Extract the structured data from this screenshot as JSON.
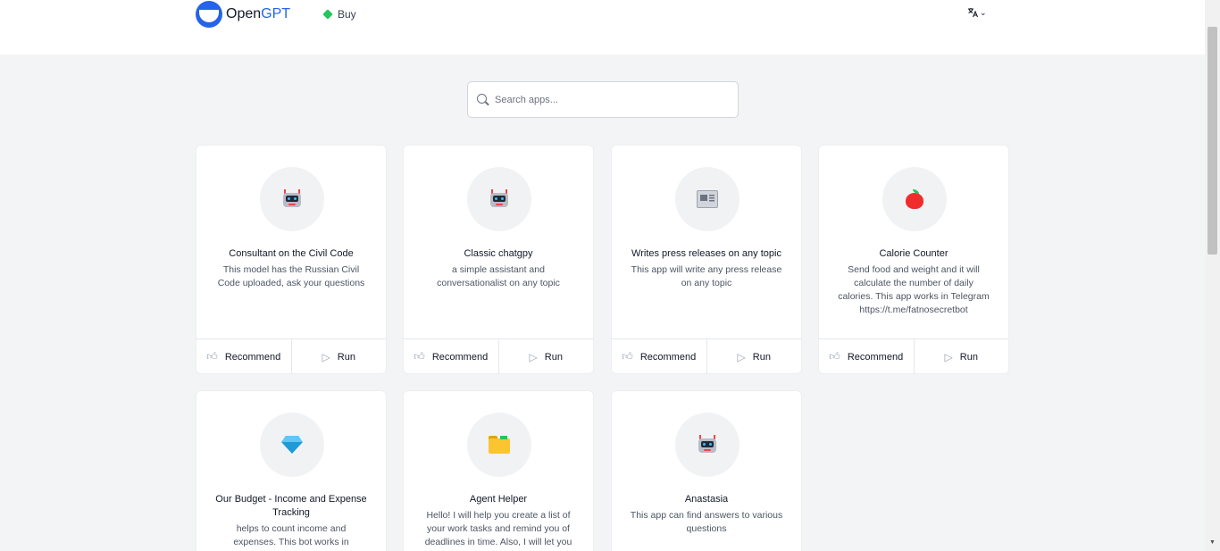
{
  "header": {
    "logo_prefix": "Open",
    "logo_suffix": "GPT",
    "buy_label": "Buy",
    "language_icon": "translate-icon",
    "accent_color": "#2563eb"
  },
  "search": {
    "placeholder": "Search apps..."
  },
  "actions": {
    "recommend_label": "Recommend",
    "run_label": "Run"
  },
  "apps": [
    {
      "title": "Consultant on the Civil Code",
      "description": "This model has the Russian Civil Code uploaded, ask your questions",
      "icon": "robot-icon"
    },
    {
      "title": "Classic chatgpy",
      "description": "a simple assistant and conversationalist on any topic",
      "icon": "robot-icon"
    },
    {
      "title": "Writes press releases on any topic",
      "description": "This app will write any press release on any topic",
      "icon": "newspaper-icon"
    },
    {
      "title": "Calorie Counter",
      "description": "Send food and weight and it will calculate the number of daily calories. This app works in Telegram https://t.me/fatnosecretbot",
      "icon": "apple-icon"
    },
    {
      "title": "Our Budget - Income and Expense Tracking",
      "description": "helps to count income and expenses. This bot works in",
      "icon": "gem-icon"
    },
    {
      "title": "Agent Helper",
      "description": "Hello! I will help you create a list of your work tasks and remind you of deadlines in time. Also, I will let you",
      "icon": "folder-icon"
    },
    {
      "title": "Anastasia",
      "description": "This app can find answers to various questions",
      "icon": "robot-icon"
    }
  ]
}
